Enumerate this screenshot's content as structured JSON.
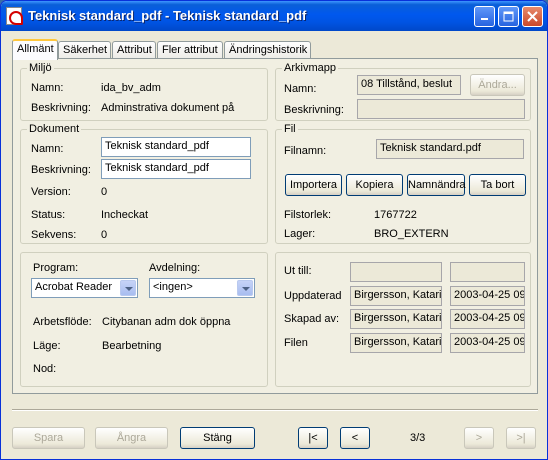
{
  "window": {
    "title": "Teknisk standard_pdf - Teknisk standard_pdf"
  },
  "tabs": [
    "Allmänt",
    "Säkerhet",
    "Attribut",
    "Fler attribut",
    "Ändringshistorik"
  ],
  "miljo": {
    "title": "Miljö",
    "namn_label": "Namn:",
    "namn_value": "ida_bv_adm",
    "beskrivning_label": "Beskrivning:",
    "beskrivning_value": "Adminstrativa dokument på"
  },
  "dokument": {
    "title": "Dokument",
    "namn_label": "Namn:",
    "namn_value": "Teknisk standard_pdf",
    "beskrivning_label": "Beskrivning:",
    "beskrivning_value": "Teknisk standard_pdf",
    "version_label": "Version:",
    "version_value": "0",
    "status_label": "Status:",
    "status_value": "Incheckat",
    "sekvens_label": "Sekvens:",
    "sekvens_value": "0"
  },
  "program": {
    "program_label": "Program:",
    "program_value": "Acrobat Reader",
    "avdelning_label": "Avdelning:",
    "avdelning_value": "<ingen>",
    "arbetsflode_label": "Arbetsflöde:",
    "arbetsflode_value": "Citybanan adm dok öppna",
    "lage_label": "Läge:",
    "lage_value": "Bearbetning",
    "nod_label": "Nod:"
  },
  "arkivmapp": {
    "title": "Arkivmapp",
    "namn_label": "Namn:",
    "namn_value": "08 Tillstånd, beslut",
    "andra_button": "Ändra...",
    "beskrivning_label": "Beskrivning:",
    "beskrivning_value": ""
  },
  "fil": {
    "title": "Fil",
    "filnamn_label": "Filnamn:",
    "filnamn_value": "Teknisk standard.pdf",
    "importera": "Importera",
    "kopiera": "Kopiera",
    "namnandra": "Namnändra",
    "ta_bort": "Ta bort",
    "filstorlek_label": "Filstorlek:",
    "filstorlek_value": "1767722",
    "lager_label": "Lager:",
    "lager_value": "BRO_EXTERN"
  },
  "history": {
    "ut_till_label": "Ut till:",
    "uppdaterad_label": "Uppdaterad",
    "uppdaterad_user": "Birgersson, Katari",
    "uppdaterad_date": "2003-04-25 09",
    "skapad_label": "Skapad av:",
    "skapad_user": "Birgersson, Katari",
    "skapad_date": "2003-04-25 09",
    "filen_label": "Filen",
    "filen_user": "Birgersson, Katari",
    "filen_date": "2003-04-25 09"
  },
  "footer": {
    "spara": "Spara",
    "angra": "Ångra",
    "stang": "Stäng",
    "first": "|<",
    "prev": "<",
    "counter": "3/3",
    "next": ">",
    "last": ">|"
  }
}
